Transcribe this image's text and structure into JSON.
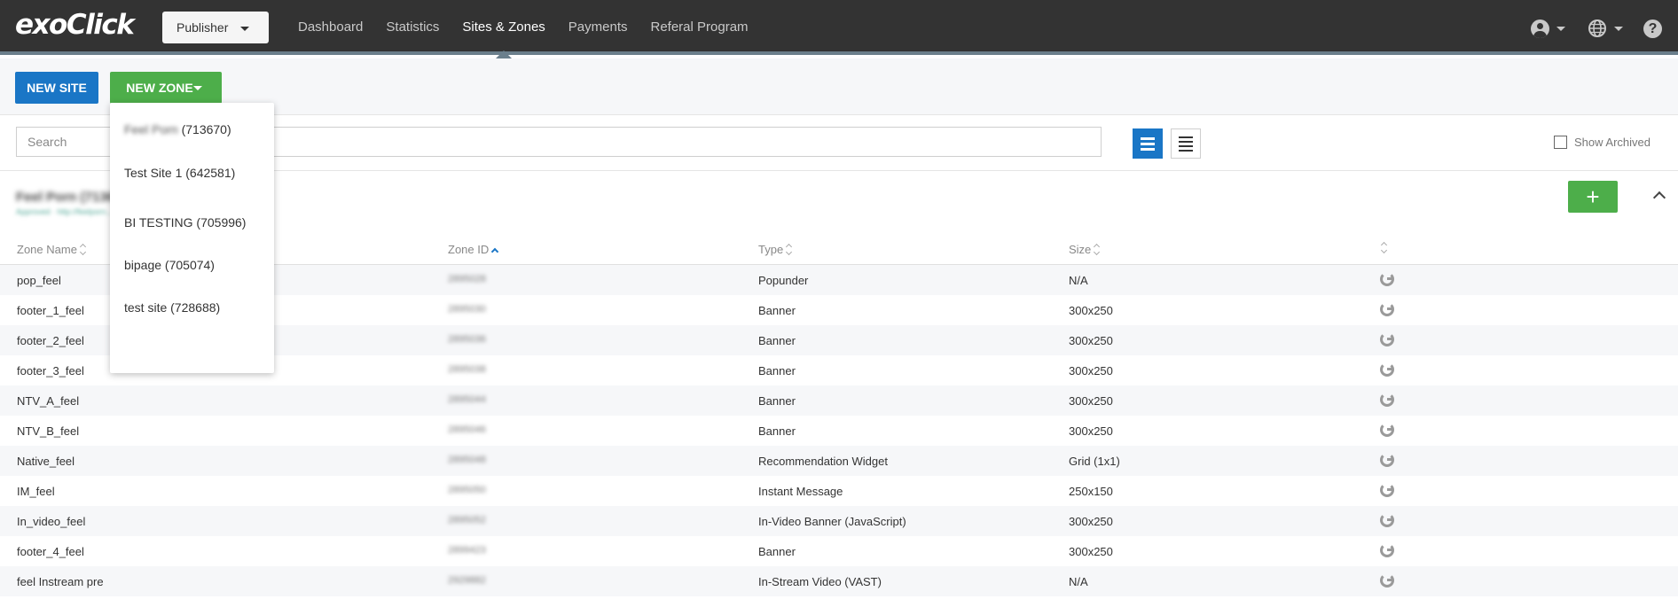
{
  "brand": {
    "logo_text": "exoClick"
  },
  "topbar": {
    "role": "Publisher",
    "nav": [
      {
        "label": "Dashboard"
      },
      {
        "label": "Statistics"
      },
      {
        "label": "Sites & Zones"
      },
      {
        "label": "Payments"
      },
      {
        "label": "Referal Program"
      }
    ],
    "help_glyph": "?"
  },
  "actions": {
    "new_site": "NEW SITE",
    "new_zone": "NEW ZONE"
  },
  "dropdown": {
    "items": [
      {
        "name": "Feel Porn",
        "id": "(713670)"
      },
      {
        "label": "Test Site 1 (642581)"
      },
      {
        "label": "BI TESTING (705996)"
      },
      {
        "label": "bipage (705074)"
      },
      {
        "label": "test site (728688)"
      }
    ]
  },
  "search": {
    "placeholder": "Search"
  },
  "filters": {
    "show_archived": "Show Archived"
  },
  "site": {
    "title": "Feel Porn   (713670)",
    "subtitle": "Approved · http://feelporn...",
    "add_glyph": "+"
  },
  "table": {
    "headers": {
      "name": "Zone Name",
      "id": "Zone ID",
      "type": "Type",
      "size": "Size"
    },
    "rows": [
      {
        "name": "pop_feel",
        "id": "2895028",
        "type": "Popunder",
        "size": "N/A"
      },
      {
        "name": "footer_1_feel",
        "id": "2895030",
        "type": "Banner",
        "size": "300x250"
      },
      {
        "name": "footer_2_feel",
        "id": "2895036",
        "type": "Banner",
        "size": "300x250"
      },
      {
        "name": "footer_3_feel",
        "id": "2895038",
        "type": "Banner",
        "size": "300x250"
      },
      {
        "name": "NTV_A_feel",
        "id": "2895044",
        "type": "Banner",
        "size": "300x250"
      },
      {
        "name": "NTV_B_feel",
        "id": "2895046",
        "type": "Banner",
        "size": "300x250"
      },
      {
        "name": "Native_feel",
        "id": "2895048",
        "type": "Recommendation Widget",
        "size": "Grid (1x1)"
      },
      {
        "name": "IM_feel",
        "id": "2895050",
        "type": "Instant Message",
        "size": "250x150"
      },
      {
        "name": "In_video_feel",
        "id": "2895052",
        "type": "In-Video Banner (JavaScript)",
        "size": "300x250"
      },
      {
        "name": "footer_4_feel",
        "id": "2899423",
        "type": "Banner",
        "size": "300x250"
      },
      {
        "name": "feel Instream pre",
        "id": "2929882",
        "type": "In-Stream Video (VAST)",
        "size": "N/A"
      }
    ]
  },
  "colors": {
    "topbar": "#333333",
    "primary": "#1a76c6",
    "success": "#4dae4a"
  }
}
